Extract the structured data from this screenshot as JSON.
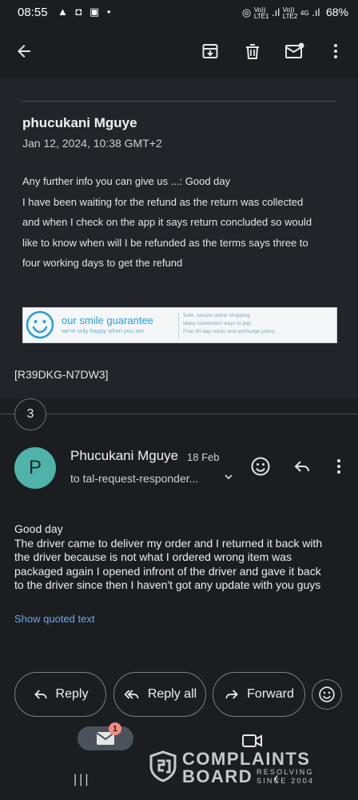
{
  "status_bar": {
    "time": "08:55",
    "left_icons": "▲ ◘ ▣ •",
    "signal_label_1": "Vo))\nLTE1",
    "signal_label_2": "Vo))\nLTE2",
    "network": "4G",
    "battery": "68%"
  },
  "toolbar": {
    "icons": [
      "back-arrow-icon",
      "archive-icon",
      "trash-icon",
      "mark-unread-icon",
      "more-vert-icon"
    ]
  },
  "older_message": {
    "sender": "phucukani Mguye",
    "date": "Jan 12, 2024, 10:38 GMT+2",
    "body_lines": [
      "Any further info you can give us ...: Good day",
      "I have been waiting for the refund as the return was collected",
      "and when I check on the app it says return concluded so would",
      "like to know when will I be refunded as the terms says three to",
      "four working days to get the refund"
    ],
    "banner": {
      "title": "our smile guarantee",
      "subtitle": "we're only happy when you are",
      "points": [
        "Safe, secure online shopping",
        "Many convenient ways to pay",
        "Free 30-day return and exchange policy"
      ]
    },
    "reference": "[R39DKG-N7DW3]"
  },
  "thread": {
    "collapsed_count": "3"
  },
  "latest_message": {
    "avatar_letter": "P",
    "sender": "Phucukani Mguye",
    "date": "18 Feb",
    "to": "to tal-request-responder...",
    "body_lines": [
      "Good day",
      "The driver came to deliver my order and I returned it back with",
      "the driver because is not what I ordered wrong item was",
      "packaged again I opened infront of the driver and gave it back",
      "to the driver since then I haven't got any update with you guys"
    ],
    "show_quoted": "Show quoted text"
  },
  "actions": {
    "reply": "Reply",
    "reply_all": "Reply all",
    "forward": "Forward"
  },
  "bottom_nav": {
    "mail_badge": "1",
    "recents_glyph": "|||",
    "back_glyph": "‹"
  },
  "watermark": {
    "line1": "COMPLAINTS",
    "line2": "BOARD",
    "tag1": "RESOLVING",
    "tag2": "SINCE 2004"
  },
  "colors": {
    "background": "#1b1e21",
    "older_card": "#212529",
    "avatar": "#4fb3a9",
    "link": "#6ea7ef",
    "badge": "#f28b82"
  }
}
